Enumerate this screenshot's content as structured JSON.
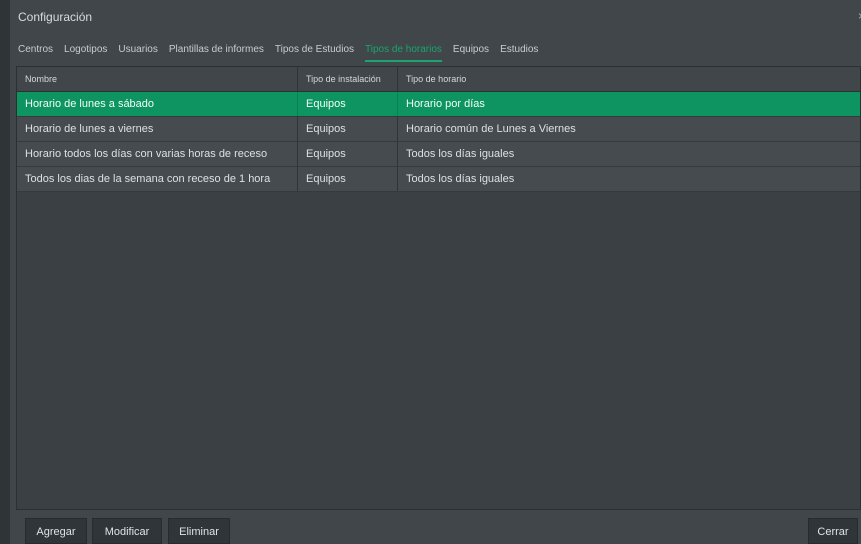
{
  "window": {
    "title": "Configuración",
    "close_glyph": "×"
  },
  "tabs": [
    {
      "label": "Centros"
    },
    {
      "label": "Logotipos"
    },
    {
      "label": "Usuarios"
    },
    {
      "label": "Plantillas de informes"
    },
    {
      "label": "Tipos de Estudios"
    },
    {
      "label": "Tipos de horarios",
      "active": true
    },
    {
      "label": "Equipos"
    },
    {
      "label": "Estudios"
    }
  ],
  "table": {
    "headers": [
      "Nombre",
      "Tipo de instalación",
      "Tipo de horario"
    ],
    "rows": [
      {
        "nombre": "Horario de lunes a sábado",
        "instalacion": "Equipos",
        "horario": "Horario por días",
        "selected": true
      },
      {
        "nombre": "Horario de lunes a viernes",
        "instalacion": "Equipos",
        "horario": "Horario común de Lunes a Viernes"
      },
      {
        "nombre": "Horario todos los días con varias horas de receso",
        "instalacion": "Equipos",
        "horario": "Todos los días iguales"
      },
      {
        "nombre": "Todos los dias de la semana con receso de 1 hora",
        "instalacion": "Equipos",
        "horario": "Todos los días iguales"
      }
    ]
  },
  "buttons": {
    "add": "Agregar",
    "modify": "Modificar",
    "delete": "Eliminar",
    "close": "Cerrar"
  },
  "colors": {
    "accent": "#19a56b",
    "selected_row": "#0e9460"
  }
}
